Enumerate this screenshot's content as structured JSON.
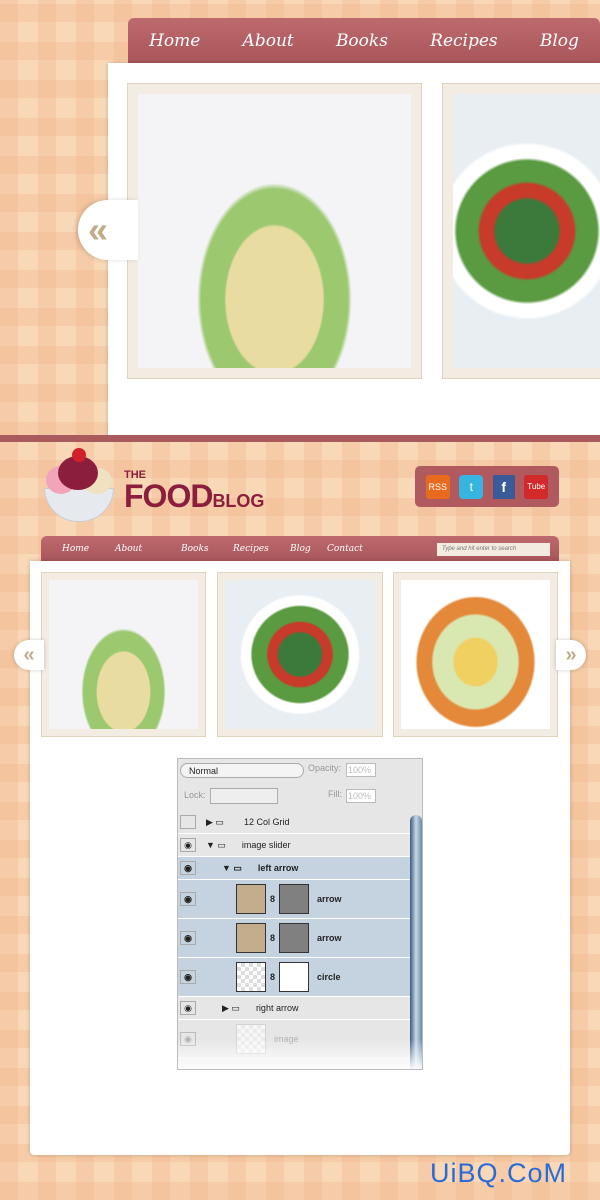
{
  "top_nav": {
    "items": [
      "Home",
      "About",
      "Books",
      "Recipes",
      "Blog"
    ]
  },
  "logo": {
    "the": "THE",
    "food": "FOOD",
    "blog": "BLOG"
  },
  "social": [
    {
      "icon": "rss-icon",
      "label": "RSS",
      "color": "#e86a1e"
    },
    {
      "icon": "twitter-icon",
      "label": "t",
      "color": "#35b5e0"
    },
    {
      "icon": "facebook-icon",
      "label": "f",
      "color": "#3b5a98"
    },
    {
      "icon": "youtube-icon",
      "label": "Tube",
      "color": "#d22a2a"
    }
  ],
  "main_nav": {
    "items": [
      "Home",
      "About",
      "Books",
      "Recipes",
      "Blog",
      "Contact"
    ],
    "search_placeholder": "Type and hit enter to search"
  },
  "slider": {
    "left_arrow": "«",
    "right_arrow": "»"
  },
  "layers_panel": {
    "blend_mode": "Normal",
    "opacity_label": "Opacity:",
    "opacity": "100%",
    "lock_label": "Lock:",
    "fill_label": "Fill:",
    "fill": "100%",
    "layers": [
      {
        "name": "12 Col Grid",
        "type": "group",
        "visible": false
      },
      {
        "name": "image slider",
        "type": "group",
        "visible": true
      },
      {
        "name": "left arrow",
        "type": "group",
        "visible": true
      },
      {
        "name": "arrow",
        "type": "fill-layer",
        "visible": true
      },
      {
        "name": "arrow",
        "type": "fill-layer",
        "visible": true
      },
      {
        "name": "circle",
        "type": "smart-object",
        "visible": true
      },
      {
        "name": "right arrow",
        "type": "group",
        "visible": true
      },
      {
        "name": "image",
        "type": "layer",
        "visible": true
      }
    ]
  },
  "watermark": "UiBQ.CoM",
  "colors": {
    "nav": "#b05a5f",
    "background": "#f8d8b6",
    "logo": "#8a1e3c",
    "selected_layer": "#c5d3e0"
  }
}
